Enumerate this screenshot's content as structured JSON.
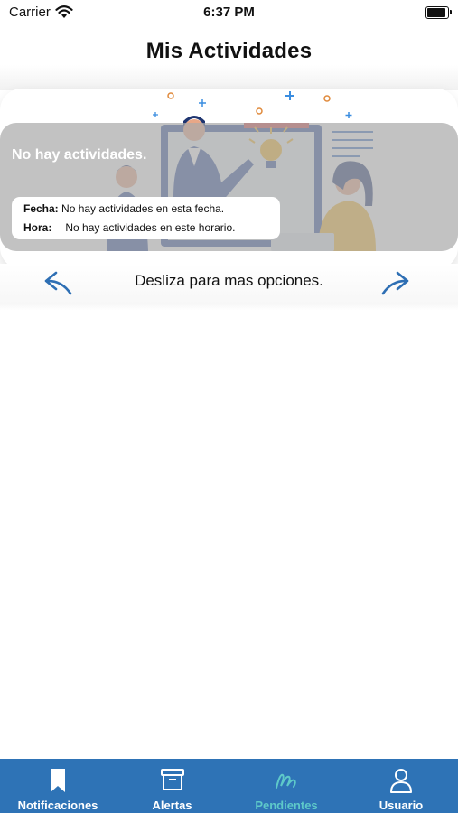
{
  "status_bar": {
    "carrier": "Carrier",
    "time": "6:37 PM"
  },
  "header": {
    "title": "Mis Actividades"
  },
  "card": {
    "message": "No hay actividades.",
    "rows": [
      {
        "label": "Fecha:",
        "value": "No hay actividades en esta fecha."
      },
      {
        "label": "Hora:",
        "value": "No hay actividades en este horario."
      }
    ]
  },
  "swipe": {
    "hint": "Desliza para mas opciones."
  },
  "tabbar": {
    "active_color": "#5ec9c9",
    "background": "#2e73b6",
    "tabs": [
      {
        "label": "Notificaciones",
        "icon": "bookmark-icon"
      },
      {
        "label": "Alertas",
        "icon": "archive-box-icon"
      },
      {
        "label": "Pendientes",
        "icon": "scribble-icon",
        "active": true
      },
      {
        "label": "Usuario",
        "icon": "person-icon"
      }
    ]
  }
}
